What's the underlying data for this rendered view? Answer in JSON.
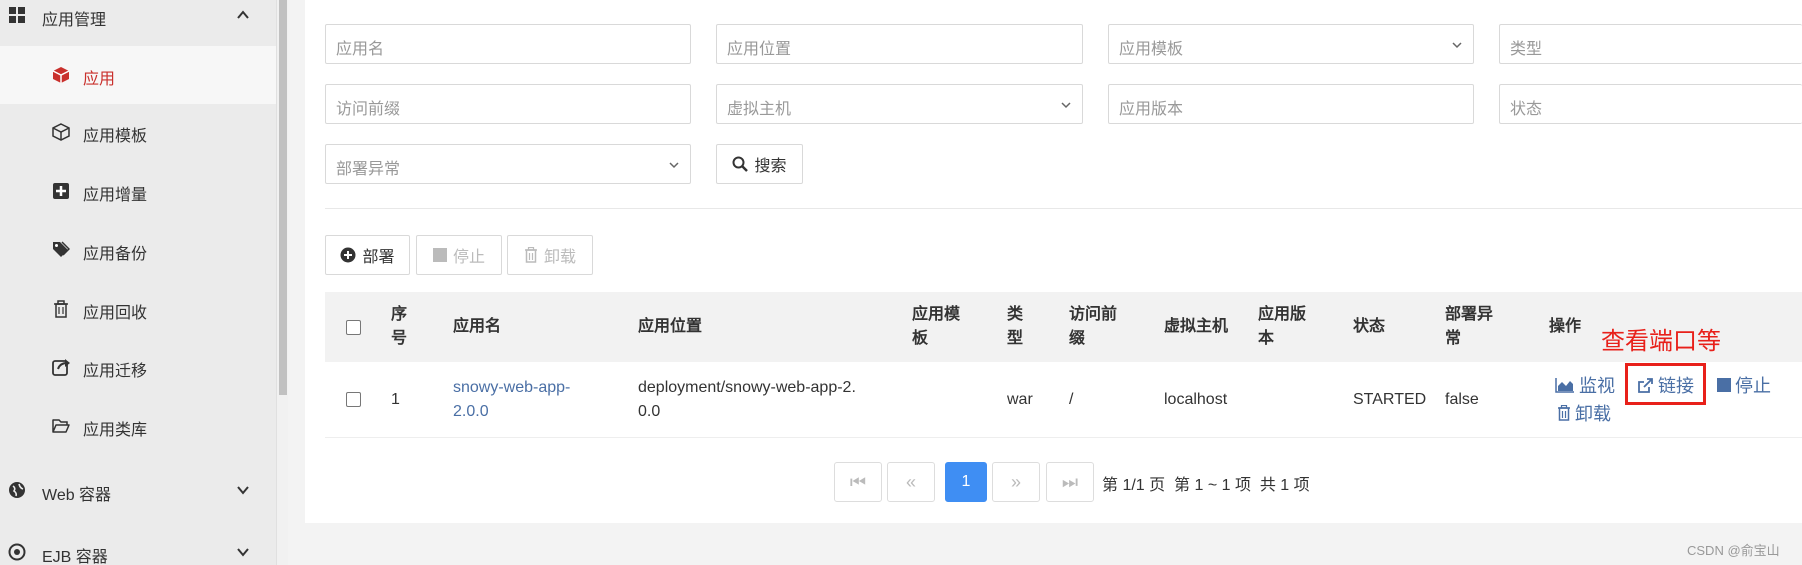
{
  "sidebar": {
    "groups": [
      {
        "label": "应用管理",
        "icon": "grid-icon",
        "chevron": "chevron-up-icon"
      },
      {
        "label": "Web 容器",
        "icon": "globe-icon",
        "chevron": "chevron-down-icon"
      },
      {
        "label": "EJB 容器",
        "icon": "target-icon",
        "chevron": "chevron-down-icon"
      }
    ],
    "items": [
      {
        "label": "应用",
        "icon": "cube-icon",
        "active": true
      },
      {
        "label": "应用模板",
        "icon": "cube-outline-icon"
      },
      {
        "label": "应用增量",
        "icon": "plus-square-icon"
      },
      {
        "label": "应用备份",
        "icon": "tags-icon"
      },
      {
        "label": "应用回收",
        "icon": "trash-icon"
      },
      {
        "label": "应用迁移",
        "icon": "share-square-icon"
      },
      {
        "label": "应用类库",
        "icon": "folder-open-icon"
      }
    ],
    "active_color": "#c9302c"
  },
  "filters": {
    "app_name": "应用名",
    "app_location": "应用位置",
    "app_template": "应用模板",
    "type": "类型",
    "access_prefix": "访问前缀",
    "virtual_host": "虚拟主机",
    "app_version": "应用版本",
    "status": "状态",
    "deploy_error": "部署异常",
    "search_button": "搜索"
  },
  "toolbar": {
    "deploy": "部署",
    "stop": "停止",
    "unload": "卸载"
  },
  "table": {
    "headers": {
      "index": "序号",
      "app_name": "应用名",
      "location": "应用位置",
      "template": "应用模板",
      "type": "类型",
      "prefix": "访问前缀",
      "vhost": "虚拟主机",
      "version": "应用版本",
      "status": "状态",
      "deploy_error": "部署异常",
      "ops": "操作"
    },
    "rows": [
      {
        "index": "1",
        "app_name": "snowy-web-app-2.0.0",
        "location": "deployment/snowy-web-app-2.0.0",
        "template": "",
        "type": "war",
        "prefix": "/",
        "vhost": "localhost",
        "version": "",
        "status": "STARTED",
        "deploy_error": "false",
        "ops": {
          "monitor": "监视",
          "link": "链接",
          "stop": "停止",
          "unload": "卸载"
        }
      }
    ]
  },
  "annotation": {
    "text": "查看端口等",
    "color": "#e8201a"
  },
  "pagination": {
    "first": "⏮",
    "prev": "«",
    "current": "1",
    "next": "»",
    "last": "⏭",
    "page_info": "第 1/1 页",
    "item_info": "第 1 ~ 1 项",
    "total_info": "共 1 项"
  },
  "watermark": "CSDN @俞宝山"
}
